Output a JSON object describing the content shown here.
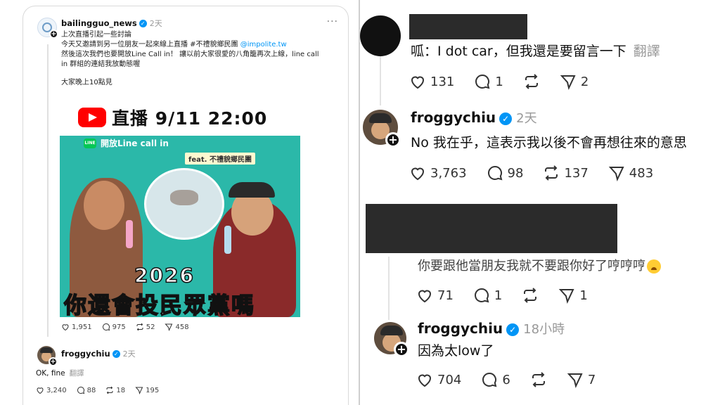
{
  "left": {
    "post": {
      "username": "bailingguo_news",
      "verified": "✓",
      "time": "2天",
      "more": "···",
      "lines": [
        "上次直播引起一些討論",
        "今天又邀請到另一位朋友一起來線上直播 #不禮貌鄉民團 ",
        "然後這次我們也要開放Line Call in！ 讓以前大家很愛的八角籠再次上線，line call",
        "in 群組的連結我放動態喔",
        "大家晚上10點見"
      ],
      "mention": "@impolite.tw",
      "thumbnail": {
        "live_title": "直播 9/11 22:00",
        "line_badge": "LINE",
        "line_text": "開放Line call in",
        "feat_text": "feat. 不禮貌鄉民團",
        "year": "2026",
        "question": "你還會投民眾黨嗎"
      },
      "stats": {
        "likes": "1,951",
        "comments": "975",
        "reposts": "52",
        "shares": "458"
      }
    },
    "reply": {
      "username": "froggychiu",
      "verified": "✓",
      "time": "2天",
      "text": "OK, fine",
      "translate": "翻譯",
      "stats": {
        "likes": "3,240",
        "comments": "88",
        "reposts": "18",
        "shares": "195"
      }
    }
  },
  "right": {
    "comment1": {
      "text": "呱：I dot car，但我還是要留言一下",
      "translate": "翻譯",
      "stats": {
        "likes": "131",
        "comments": "1",
        "shares": "2"
      }
    },
    "reply1": {
      "username": "froggychiu",
      "verified": "✓",
      "time": "2天",
      "text": "No 我在乎，這表示我以後不會再想往來的意思",
      "stats": {
        "likes": "3,763",
        "comments": "98",
        "reposts": "137",
        "shares": "483"
      }
    },
    "comment2": {
      "text": "你要跟他當朋友我就不要跟你好了哼哼哼",
      "stats": {
        "likes": "71",
        "comments": "1",
        "shares": "1"
      }
    },
    "reply2": {
      "username": "froggychiu",
      "verified": "✓",
      "time": "18小時",
      "text": "因為太low了",
      "stats": {
        "likes": "704",
        "comments": "6",
        "shares": "7"
      }
    }
  },
  "icons": {
    "plus": "+",
    "heart": "♡",
    "repost": "⟳"
  }
}
